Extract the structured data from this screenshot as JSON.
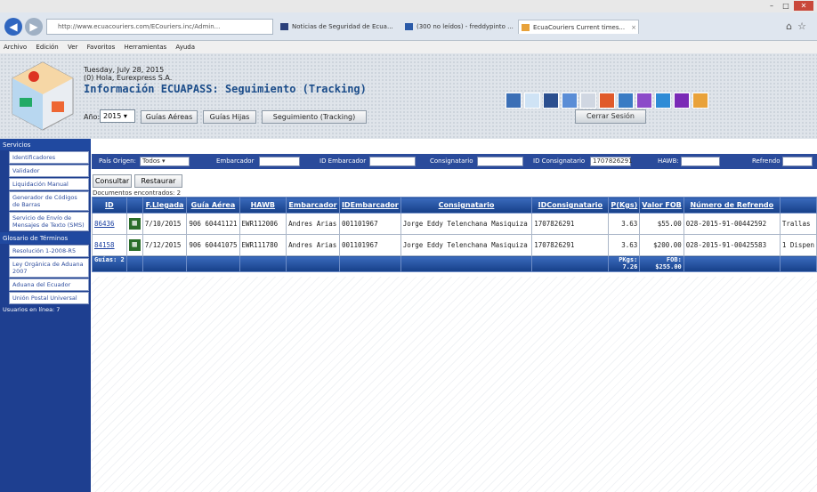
{
  "browser": {
    "url": "http://www.ecuacouriers.com/ECouriers.inc/Admin...",
    "tabs": [
      {
        "label": "Noticias de Seguridad de Ecua..."
      },
      {
        "label": "(300 no leídos) - freddypinto ..."
      },
      {
        "label": "EcuaCouriers Current times..."
      }
    ]
  },
  "menu": [
    "Archivo",
    "Edición",
    "Ver",
    "Favoritos",
    "Herramientas",
    "Ayuda"
  ],
  "header": {
    "date": "Tuesday, July 28, 2015",
    "hello": "(0) Hola, Eurexpress S.A.",
    "title": "Información ECUAPASS: Seguimiento (Tracking)",
    "year_label": "Año:",
    "year_value": "2015",
    "btn_guias_aereas": "Guías Aéreas",
    "btn_guias_hijas": "Guías Hijas",
    "btn_tracking": "Seguimiento (Tracking)",
    "logout": "Cerrar Sesión"
  },
  "sidebar": {
    "section1": "Servicios",
    "items1": [
      "Identificadores",
      "Validador",
      "Liquidación Manual",
      "Generador de Códigos de Barras",
      "Servicio de Envío de Mensajes de Texto (SMS)"
    ],
    "section2": "Glosario de Términos",
    "items2": [
      "Resolución 1-2008-R5",
      "Ley Orgánica de Aduana 2007",
      "Aduana del Ecuador",
      "Unión Postal Universal"
    ],
    "footer": "Usuarios en línea: 7"
  },
  "filters": {
    "pais_label": "País Origen:",
    "pais_value": "Todos",
    "embarcador_label": "Embarcador",
    "id_embarcador_label": "ID Embarcador",
    "consignatario_label": "Consignatario",
    "id_consignatario_label": "ID Consignatario",
    "id_consignatario_value": "1707826291",
    "hawb_label": "HAWB:",
    "refrendo_label": "Refrendo"
  },
  "actions": {
    "consultar": "Consultar",
    "restaurar": "Restaurar"
  },
  "count_text": "Documentos encontrados:     2",
  "table": {
    "headers": [
      "ID",
      "",
      "F.Llegada",
      "Guía Aérea",
      "HAWB",
      "Embarcador",
      "IDEmbarcador",
      "Consignatario",
      "IDConsignatario",
      "P(Kgs)",
      "Valor FOB",
      "Número de Refrendo",
      ""
    ],
    "rows": [
      {
        "id": "86436",
        "fecha": "7/10/2015",
        "guia": "906 60441121",
        "hawb": "EWR112006",
        "embarcador": "Andres Arias",
        "id_emb": "001101967",
        "consignatario": "Jorge Eddy Telenchana Masiquiza",
        "id_cons": "1707826291",
        "peso": "3.63",
        "fob": "$55.00",
        "refrendo": "028-2015-91-00442592",
        "extra": "Trallas"
      },
      {
        "id": "84158",
        "fecha": "7/12/2015",
        "guia": "906 60441075",
        "hawb": "EWR111780",
        "embarcador": "Andres Arias",
        "id_emb": "001101967",
        "consignatario": "Jorge Eddy Telenchana Masiquiza",
        "id_cons": "1707826291",
        "peso": "3.63",
        "fob": "$200.00",
        "refrendo": "028-2015-91-00425583",
        "extra": "1 Dispen"
      }
    ],
    "footer": {
      "guias": "Guías: 2",
      "pkgs": "PKgs: 7.26",
      "fob": "FOB: $255.00"
    }
  }
}
